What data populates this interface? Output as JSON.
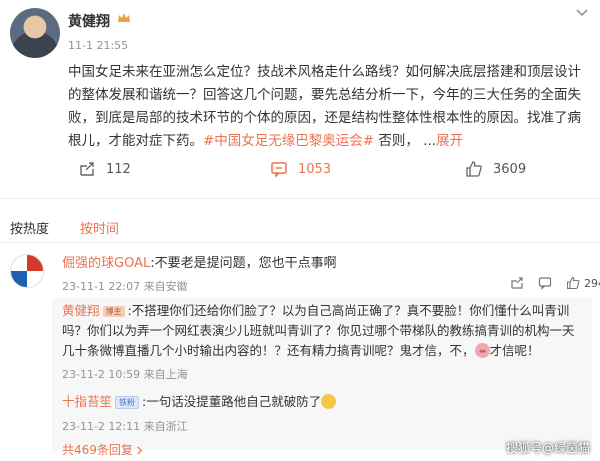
{
  "post": {
    "author": "黄健翔",
    "time": "11-1 21:55",
    "body_text": "中国女足未来在亚洲怎么定位？技战术风格走什么路线？如何解决底层搭建和顶层设计的整体发展和谐统一？回答这几个问题，要先总结分析一下，今年的三大任务的全面失败，到底是局部的技术环节的个体的原因，还是结构性整体性根本性的原因。找准了病根儿，才能对症下药。",
    "hashtag": "#中国女足无缘巴黎奥运会#",
    "tail": " 否则，  ...",
    "expand": "展开",
    "repost_count": "112",
    "comment_count": "1053",
    "like_count": "3609"
  },
  "sort": {
    "hot": "按热度",
    "time": "按时间"
  },
  "comment": {
    "name": "倔强的球GOAL",
    "text": ":不要老是提问题，您也干点事啊",
    "time": "23-11-1 22:07 来自安徽",
    "like_count": "294"
  },
  "replies": [
    {
      "name": "黄健翔",
      "badge": "博主",
      "text": ":不搭理你们还给你们脸了？以为自己高尚正确了？真不要脸！你们懂什么叫青训吗？你们以为弄一个网红表演少儿班就叫青训了？你见过哪个带梯队的教练搞青训的机构一天几十条微博直播几个小时输出内容的！？还有精力搞青训呢？鬼才信，不，",
      "tail": "才信呢！",
      "time": "23-11-2 10:59 来自上海"
    },
    {
      "name": "十指苔笙",
      "badge": "铁粉",
      "text": ":一句话没提董路他自己就破防了",
      "time": "23-11-2 12:11 来自浙江"
    }
  ],
  "more_replies": "共469条回复",
  "watermark": "搜狐号@绿茵猫",
  "colors": {
    "accent": "#eb7350",
    "meta": "#939393",
    "reply_bg": "#f7f7f7"
  }
}
